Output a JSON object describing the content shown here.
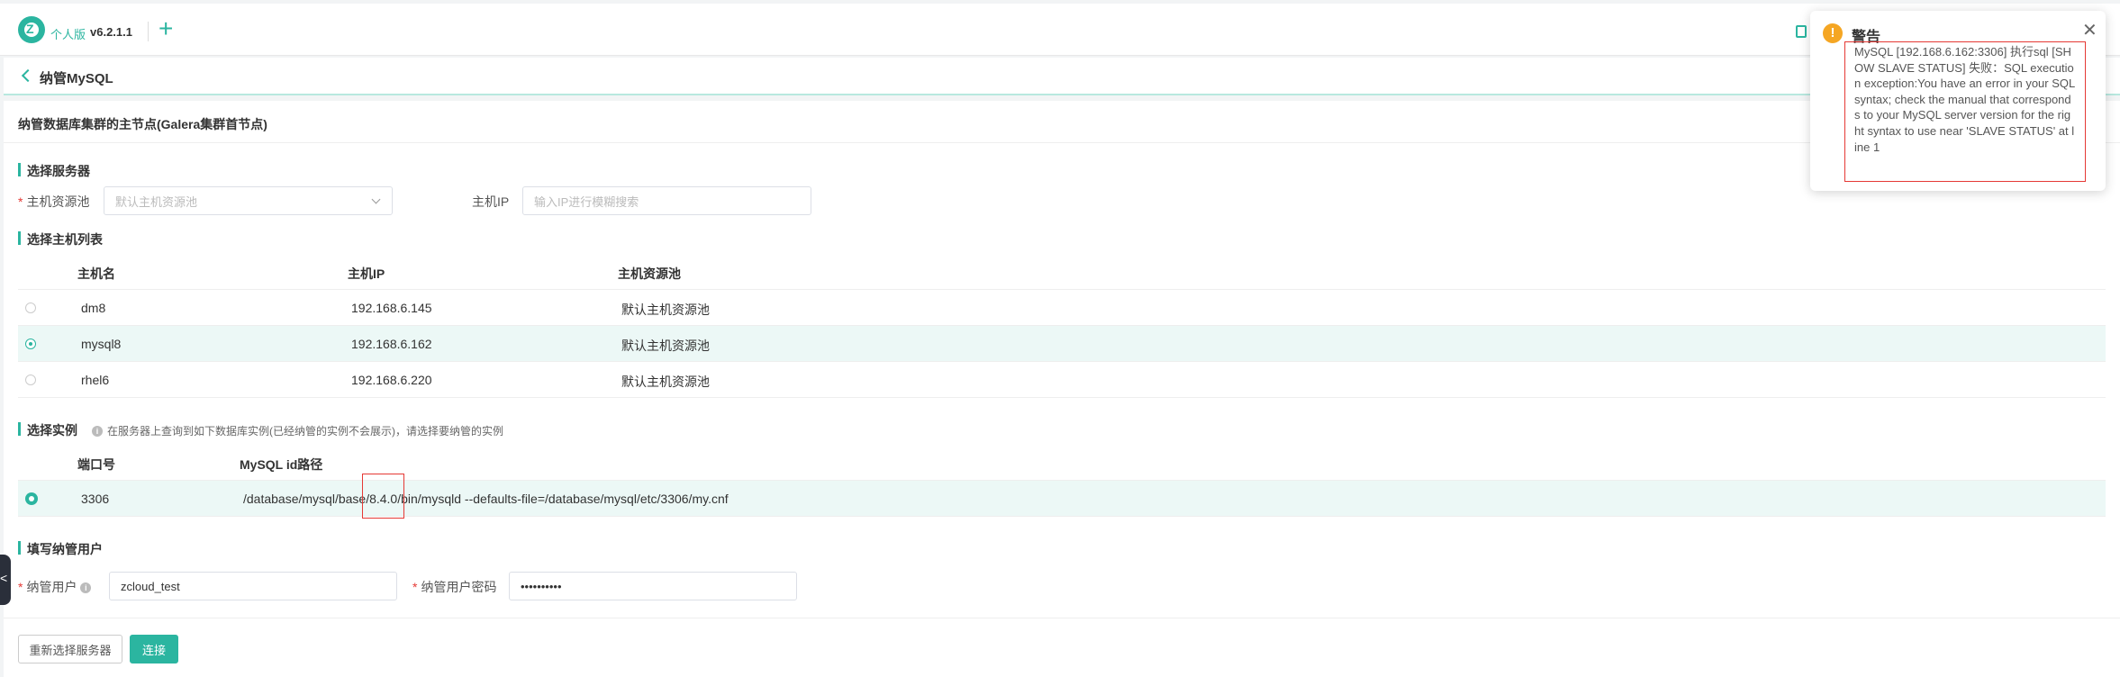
{
  "app": {
    "edition": "个人版",
    "version": "v6.2.1.1",
    "add_label": "+"
  },
  "page": {
    "title": "纳管MySQL",
    "card_title": "纳管数据库集群的主节点(Galera集群首节点)"
  },
  "server_section": {
    "title": "选择服务器",
    "pool_label": "主机资源池",
    "pool_placeholder": "默认主机资源池",
    "ip_label": "主机IP",
    "ip_placeholder": "输入IP进行模糊搜索"
  },
  "host_list": {
    "title": "选择主机列表",
    "columns": [
      "主机名",
      "主机IP",
      "主机资源池"
    ],
    "rows": [
      {
        "name": "dm8",
        "ip": "192.168.6.145",
        "pool": "默认主机资源池",
        "selected": false
      },
      {
        "name": "mysql8",
        "ip": "192.168.6.162",
        "pool": "默认主机资源池",
        "selected": true
      },
      {
        "name": "rhel6",
        "ip": "192.168.6.220",
        "pool": "默认主机资源池",
        "selected": false
      }
    ]
  },
  "instance_section": {
    "title": "选择实例",
    "hint": "在服务器上查询到如下数据库实例(已经纳管的实例不会展示)，请选择要纳管的实例",
    "columns": [
      "端口号",
      "MySQL id路径"
    ],
    "rows": [
      {
        "port": "3306",
        "path": "/database/mysql/base/8.4.0/bin/mysqld --defaults-file=/database/mysql/etc/3306/my.cnf",
        "selected": true
      }
    ]
  },
  "user_section": {
    "title": "填写纳管用户",
    "user_label": "纳管用户",
    "user_value": "zcloud_test",
    "password_label": "纳管用户密码",
    "password_value": "••••••••••"
  },
  "actions": {
    "reselect_label": "重新选择服务器",
    "connect_label": "连接"
  },
  "toast": {
    "title": "警告",
    "icon": "!",
    "close": "✕",
    "message": "MySQL [192.168.6.162:3306] 执行sql [SHOW SLAVE STATUS] 失败：SQL execution exception:You have an error in your SQL syntax; check the manual that corresponds to your MySQL server version for the right syntax to use near 'SLAVE STATUS' at line 1"
  },
  "side_tab": {
    "icon": "<"
  }
}
